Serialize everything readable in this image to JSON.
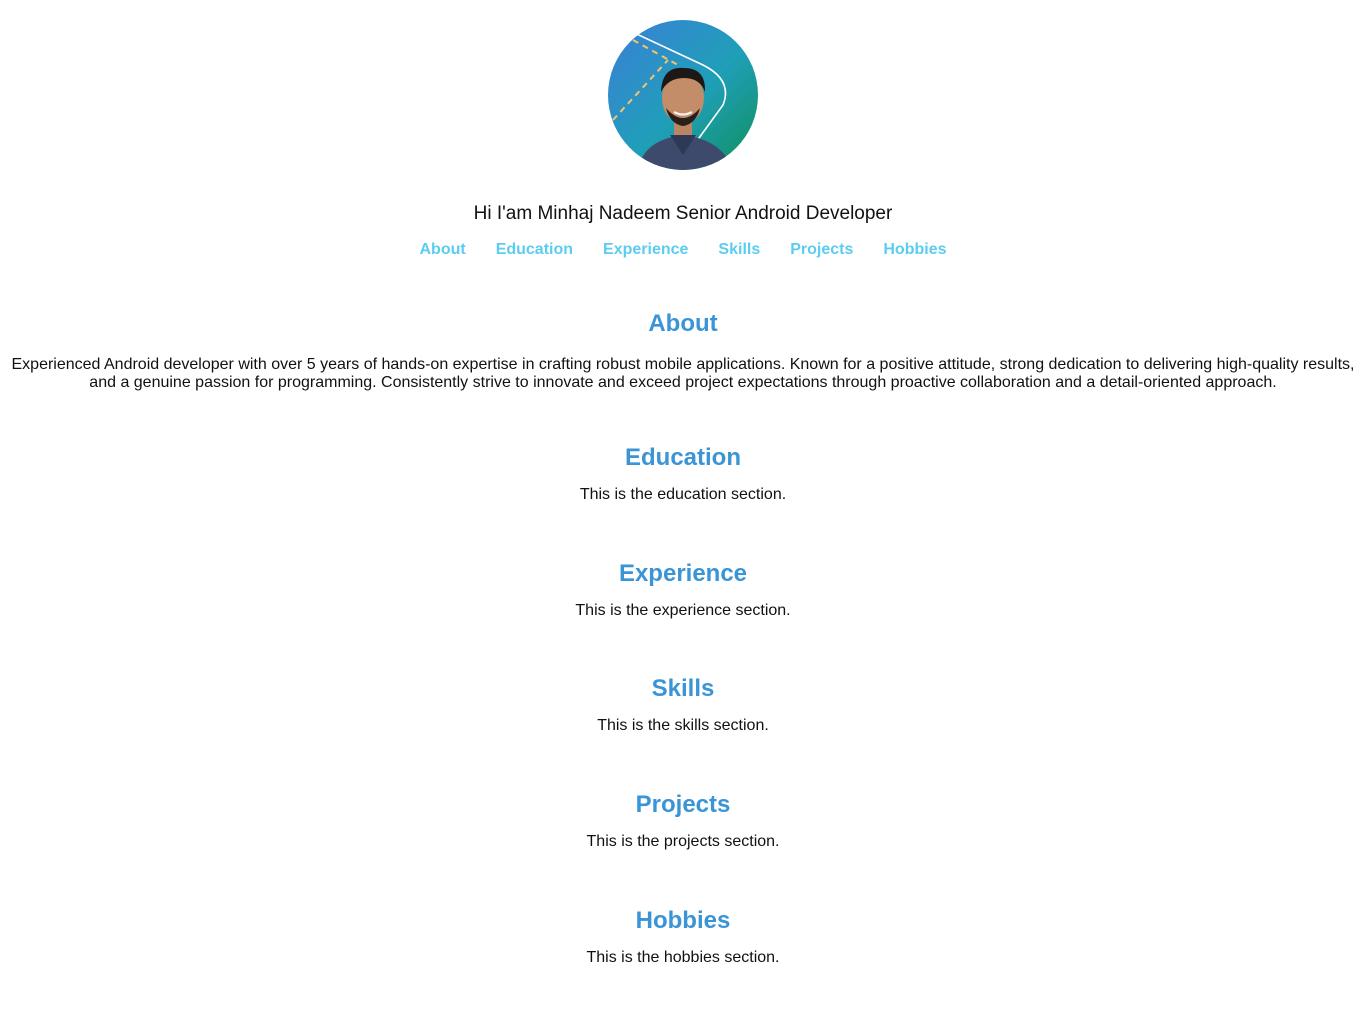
{
  "colors": {
    "nav_link": "#5bcdf0",
    "section_heading": "#3a95d6",
    "body_text": "#111111",
    "background": "#ffffff"
  },
  "profile": {
    "avatar_description_icon": "profile-photo",
    "intro": "Hi I'am Minhaj Nadeem Senior Android Developer"
  },
  "nav": {
    "items": [
      {
        "label": "About"
      },
      {
        "label": "Education"
      },
      {
        "label": "Experience"
      },
      {
        "label": "Skills"
      },
      {
        "label": "Projects"
      },
      {
        "label": "Hobbies"
      }
    ]
  },
  "sections": {
    "about": {
      "title": "About",
      "body": "Experienced Android developer with over 5 years of hands-on expertise in crafting robust mobile applications. Known for a positive attitude, strong dedication to delivering high-quality results, and a genuine passion for programming. Consistently strive to innovate and exceed project expectations through proactive collaboration and a detail-oriented approach."
    },
    "education": {
      "title": "Education",
      "body": "This is the education section."
    },
    "experience": {
      "title": "Experience",
      "body": "This is the experience section."
    },
    "skills": {
      "title": "Skills",
      "body": "This is the skills section."
    },
    "projects": {
      "title": "Projects",
      "body": "This is the projects section."
    },
    "hobbies": {
      "title": "Hobbies",
      "body": "This is the hobbies section."
    }
  }
}
